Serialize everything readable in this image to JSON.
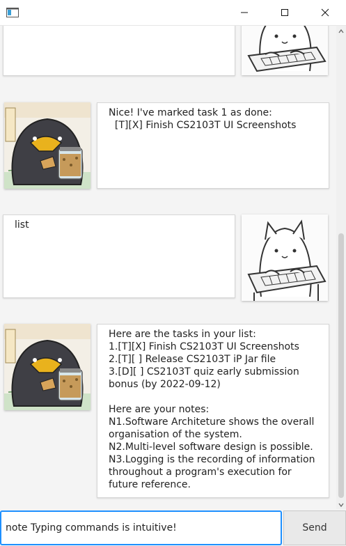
{
  "window": {
    "icon": "app-window-icon",
    "controls": [
      "minimize",
      "maximize",
      "close"
    ]
  },
  "messages": [
    {
      "sender": "user",
      "avatar": "cat-avatar",
      "text": ""
    },
    {
      "sender": "bot",
      "avatar": "penguin-avatar",
      "text": "Nice! I've marked task 1 as done:\n  [T][X] Finish CS2103T UI Screenshots"
    },
    {
      "sender": "user",
      "avatar": "cat-avatar",
      "text": "list"
    },
    {
      "sender": "bot",
      "avatar": "penguin-avatar",
      "text": "Here are the tasks in your list:\n1.[T][X] Finish CS2103T UI Screenshots\n2.[T][ ] Release CS2103T iP Jar file\n3.[D][ ] CS2103T quiz early submission\nbonus (by 2022-09-12)\n\nHere are your notes:\nN1.Software Architeture shows the overall\norganisation of the system.\nN2.Multi-level software design is possible.\nN3.Logging is the recording of information\nthroughout a program's execution for\nfuture reference."
    }
  ],
  "input": {
    "value": "note Typing commands is intuitive!",
    "send_label": "Send"
  },
  "colors": {
    "accent": "#1e90ff",
    "background": "#f4f4f4",
    "bubble": "#ffffff"
  }
}
